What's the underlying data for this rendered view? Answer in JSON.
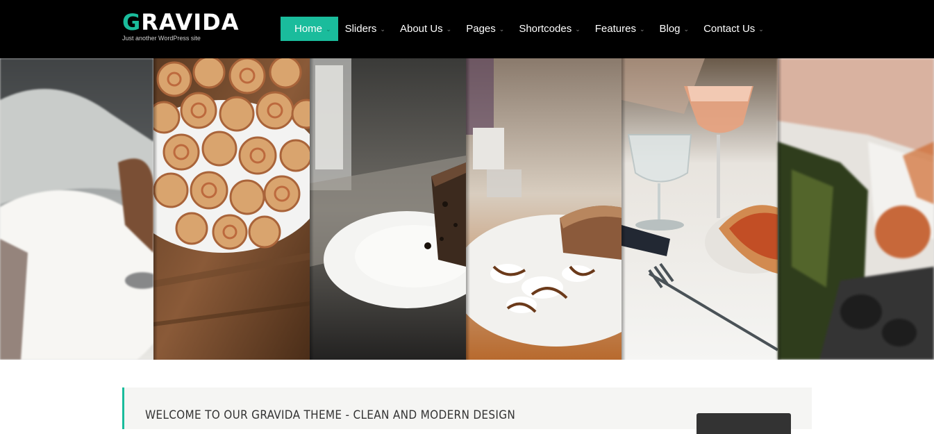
{
  "site": {
    "title_first": "G",
    "title_rest": "RAVIDA",
    "tagline": "Just another WordPress site"
  },
  "nav": {
    "items": [
      {
        "label": "Home",
        "active": true
      },
      {
        "label": "Sliders"
      },
      {
        "label": "About Us"
      },
      {
        "label": "Pages"
      },
      {
        "label": "Shortcodes"
      },
      {
        "label": "Features"
      },
      {
        "label": "Blog"
      },
      {
        "label": "Contact Us"
      }
    ],
    "caret": "⌄"
  },
  "welcome": {
    "heading": "WELCOME TO OUR GRAVIDA THEME - CLEAN AND MODERN DESIGN"
  },
  "colors": {
    "accent": "#1abc9c",
    "header_bg": "#000000"
  }
}
